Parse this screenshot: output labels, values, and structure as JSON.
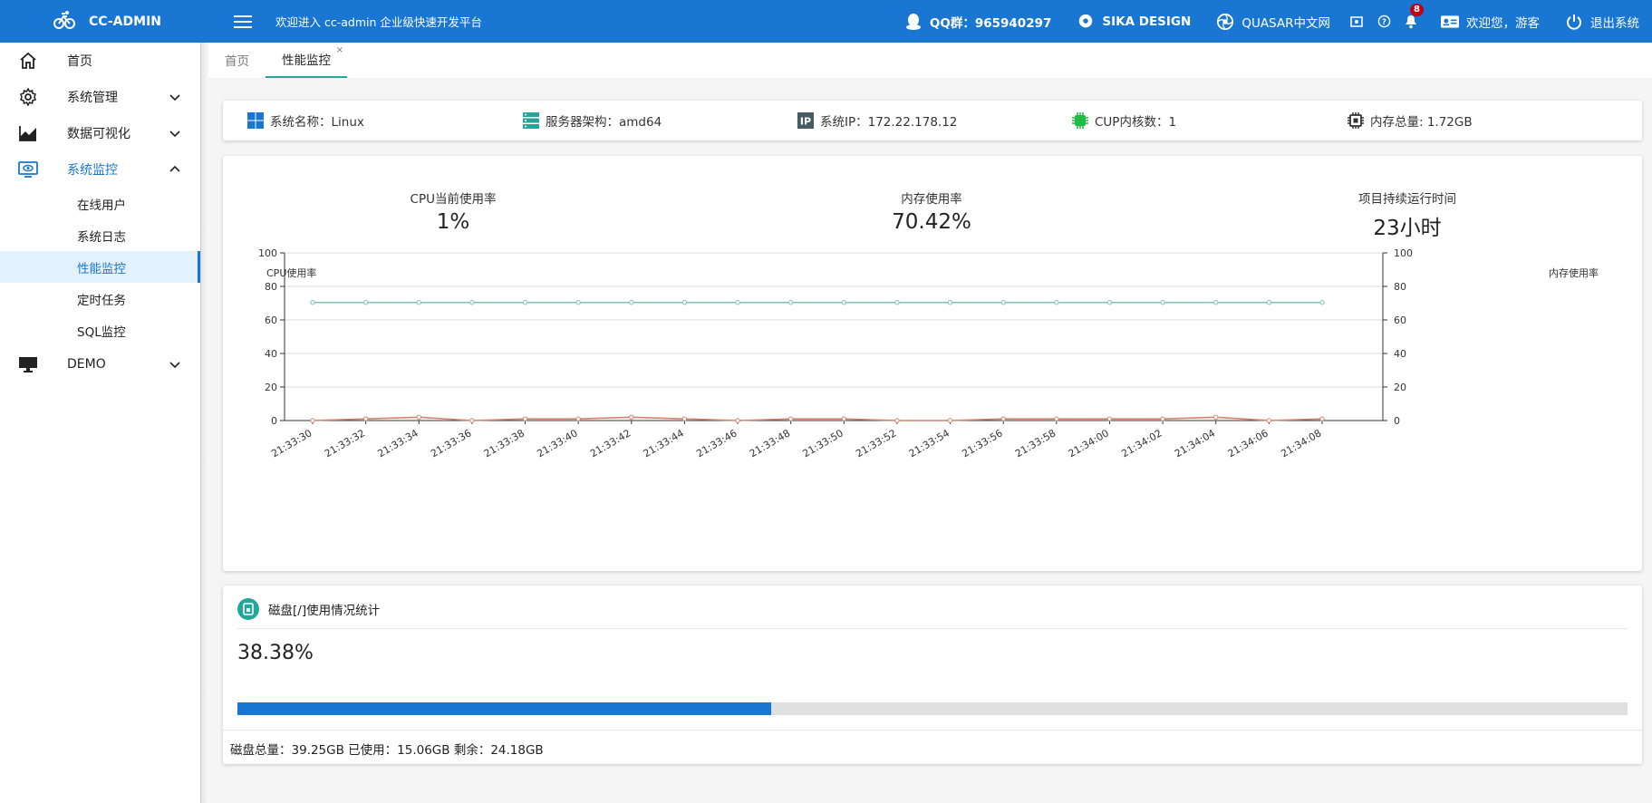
{
  "header": {
    "brand": "CC-ADMIN",
    "welcome": "欢迎进入 cc-admin 企业级快速开发平台",
    "qq": "QQ群：965940297",
    "sika": "SIKA DESIGN",
    "quasar": "QUASAR中文网",
    "notification_count": "8",
    "user_greeting": "欢迎您，游客",
    "logout": "退出系统",
    "color": "#1976d2"
  },
  "sidebar": {
    "items": [
      {
        "label": "首页",
        "icon": "home-icon"
      },
      {
        "label": "系统管理",
        "icon": "gear-icon"
      },
      {
        "label": "数据可视化",
        "icon": "chart-icon"
      },
      {
        "label": "系统监控",
        "icon": "eye-icon"
      },
      {
        "label": "DEMO",
        "icon": "monitor-icon"
      }
    ],
    "sub_items": [
      "在线用户",
      "系统日志",
      "性能监控",
      "定时任务",
      "SQL监控"
    ]
  },
  "tabs": [
    {
      "label": "首页"
    },
    {
      "label": "性能监控",
      "close": "×"
    }
  ],
  "info": {
    "os": "系统名称：Linux",
    "arch": "服务器架构：amd64",
    "ip": "系统IP：172.22.178.12",
    "cores": "CUP内核数：1",
    "memory": "内存总量: 1.72GB"
  },
  "stats": {
    "cpu_label": "CPU当前使用率",
    "cpu_value": "1%",
    "mem_label": "内存使用率",
    "mem_value": "70.42%",
    "uptime_label": "项目持续运行时间",
    "uptime_value": "23小时"
  },
  "chart_data": {
    "type": "line",
    "ylabel_left": "CPU使用率",
    "ylabel_right": "内存使用率",
    "ylim": [
      0,
      100
    ],
    "y_ticks": [
      0,
      20,
      40,
      60,
      80,
      100
    ],
    "grid": true,
    "categories": [
      "21:33:30",
      "21:33:32",
      "21:33:34",
      "21:33:36",
      "21:33:38",
      "21:33:40",
      "21:33:42",
      "21:33:44",
      "21:33:46",
      "21:33:48",
      "21:33:50",
      "21:33:52",
      "21:33:54",
      "21:33:56",
      "21:33:58",
      "21:34:00",
      "21:34:02",
      "21:34:04",
      "21:34:06",
      "21:34:08"
    ],
    "series": [
      {
        "color": "#7ec3b4",
        "values": [
          70.4,
          70.4,
          70.4,
          70.4,
          70.4,
          70.4,
          70.4,
          70.4,
          70.4,
          70.4,
          70.4,
          70.4,
          70.4,
          70.4,
          70.4,
          70.4,
          70.4,
          70.4,
          70.4,
          70.4
        ]
      },
      {
        "color": "#d4836b",
        "values": [
          0,
          1,
          2,
          0,
          1,
          1,
          2,
          1,
          0,
          1,
          1,
          0,
          0,
          1,
          1,
          1,
          1,
          2,
          0,
          1
        ]
      }
    ]
  },
  "disk": {
    "title": "磁盘[/]使用情况统计",
    "percent_text": "38.38%",
    "percent": 38.38,
    "footer": "磁盘总量：39.25GB 已使用：15.06GB 剩余：24.18GB"
  }
}
